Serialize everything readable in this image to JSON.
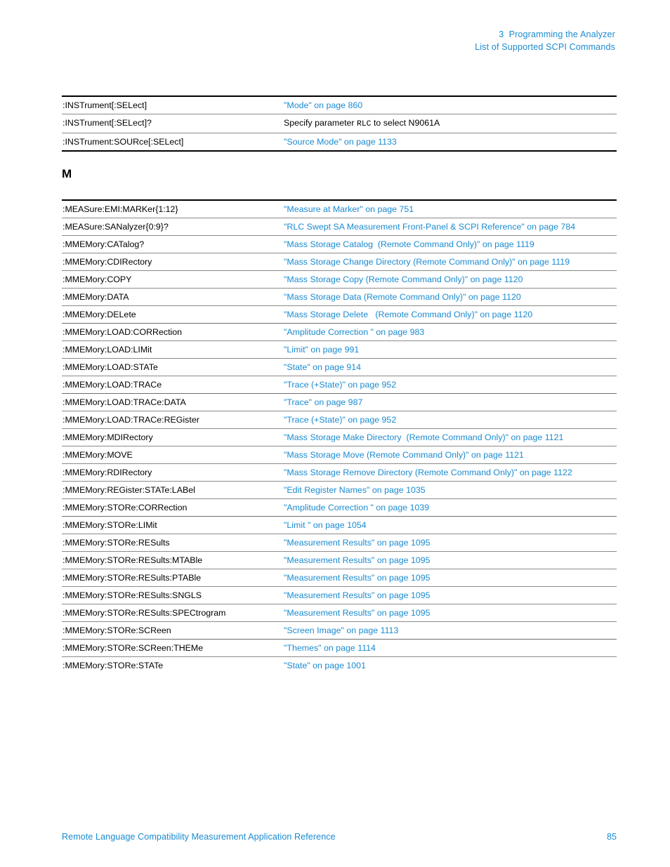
{
  "header": {
    "chapter_line": "3  Programming the Analyzer",
    "section_line": "List of Supported SCPI Commands",
    "accent_color": "#1b8bd0"
  },
  "footer": {
    "title": "Remote Language Compatibility Measurement Application Reference",
    "page_number": "85"
  },
  "sections": [
    {
      "heading": "",
      "rows": [
        {
          "command": ":INSTrument[:SELect]",
          "target": "\"Mode\" on page 860",
          "link": true
        },
        {
          "command": ":INSTrument[:SELect]?",
          "target_prefix": "Specify parameter ",
          "target_mono": "RLC",
          "target_suffix": " to select N9061A",
          "link": false
        },
        {
          "command": ":INSTrument:SOURce[:SELect]",
          "target": "\"Source Mode\" on page 1133",
          "link": true
        }
      ]
    },
    {
      "heading": "M",
      "rows": [
        {
          "command": ":MEASure:EMI:MARKer{1:12}",
          "target": "\"Measure at Marker\" on page 751",
          "link": true
        },
        {
          "command": ":MEASure:SANalyzer{0:9}?",
          "target": "\"RLC Swept SA Measurement Front-Panel & SCPI Reference\" on page 784",
          "link": true
        },
        {
          "command": ":MMEMory:CATalog?",
          "target": "\"Mass Storage Catalog  (Remote Command Only)\" on page 1119",
          "link": true
        },
        {
          "command": ":MMEMory:CDIRectory",
          "target": "\"Mass Storage Change Directory (Remote Command Only)\" on page 1119",
          "link": true
        },
        {
          "command": ":MMEMory:COPY",
          "target": "\"Mass Storage Copy (Remote Command Only)\" on page 1120",
          "link": true
        },
        {
          "command": ":MMEMory:DATA",
          "target": "\"Mass Storage Data (Remote Command Only)\" on page 1120",
          "link": true
        },
        {
          "command": ":MMEMory:DELete",
          "target": "\"Mass Storage Delete   (Remote Command Only)\" on page 1120",
          "link": true
        },
        {
          "command": ":MMEMory:LOAD:CORRection",
          "target": "\"Amplitude Correction \" on page 983",
          "link": true
        },
        {
          "command": ":MMEMory:LOAD:LIMit",
          "target": "\"Limit\" on page 991",
          "link": true
        },
        {
          "command": ":MMEMory:LOAD:STATe",
          "target": "\"State\" on page 914",
          "link": true
        },
        {
          "command": ":MMEMory:LOAD:TRACe",
          "target": "\"Trace (+State)\" on page 952",
          "link": true
        },
        {
          "command": ":MMEMory:LOAD:TRACe:DATA",
          "target": "\"Trace\" on page 987",
          "link": true
        },
        {
          "command": ":MMEMory:LOAD:TRACe:REGister",
          "target": "\"Trace (+State)\" on page 952",
          "link": true
        },
        {
          "command": ":MMEMory:MDIRectory",
          "target": "\"Mass Storage Make Directory  (Remote Command Only)\" on page 1121",
          "link": true
        },
        {
          "command": ":MMEMory:MOVE",
          "target": "\"Mass Storage Move (Remote Command Only)\" on page 1121",
          "link": true
        },
        {
          "command": ":MMEMory:RDIRectory",
          "target": "\"Mass Storage Remove Directory (Remote Command Only)\" on page 1122",
          "link": true
        },
        {
          "command": ":MMEMory:REGister:STATe:LABel",
          "target": "\"Edit Register Names\" on page 1035",
          "link": true
        },
        {
          "command": ":MMEMory:STORe:CORRection",
          "target": "\"Amplitude Correction \" on page 1039",
          "link": true
        },
        {
          "command": ":MMEMory:STORe:LIMit",
          "target": "\"Limit \" on page 1054",
          "link": true
        },
        {
          "command": ":MMEMory:STORe:RESults",
          "target": "\"Measurement Results\" on page 1095",
          "link": true
        },
        {
          "command": ":MMEMory:STORe:RESults:MTABle",
          "target": "\"Measurement Results\" on page 1095",
          "link": true
        },
        {
          "command": ":MMEMory:STORe:RESults:PTABle",
          "target": "\"Measurement Results\" on page 1095",
          "link": true
        },
        {
          "command": ":MMEMory:STORe:RESults:SNGLS",
          "target": "\"Measurement Results\" on page 1095",
          "link": true
        },
        {
          "command": ":MMEMory:STORe:RESults:SPECtrogram",
          "target": "\"Measurement Results\" on page 1095",
          "link": true
        },
        {
          "command": ":MMEMory:STORe:SCReen",
          "target": "\"Screen Image\" on page 1113",
          "link": true
        },
        {
          "command": ":MMEMory:STORe:SCReen:THEMe",
          "target": "\"Themes\" on page 1114",
          "link": true
        },
        {
          "command": ":MMEMory:STORe:STATe",
          "target": "\"State\" on page 1001",
          "link": true
        }
      ]
    }
  ]
}
